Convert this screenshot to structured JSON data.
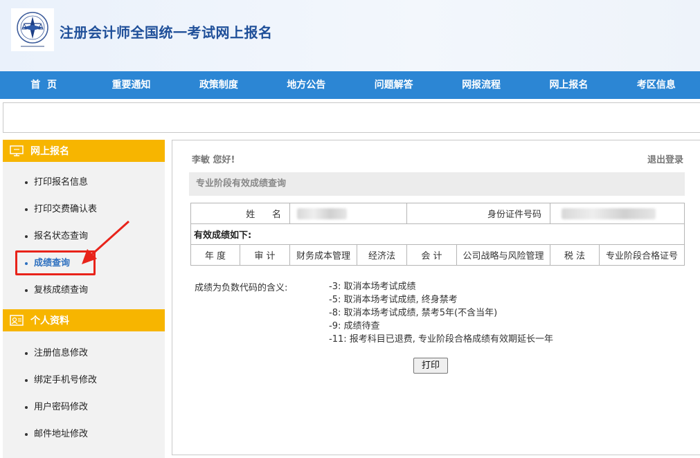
{
  "header": {
    "site_title": "注册会计师全国统一考试网上报名",
    "logo_icon": "cicpa-emblem-icon"
  },
  "nav": {
    "items": [
      {
        "label": "首  页"
      },
      {
        "label": "重要通知"
      },
      {
        "label": "政策制度"
      },
      {
        "label": "地方公告"
      },
      {
        "label": "问题解答"
      },
      {
        "label": "网报流程"
      },
      {
        "label": "网上报名"
      },
      {
        "label": "考区信息"
      }
    ]
  },
  "sidebar": {
    "section1": {
      "title": "网上报名",
      "icon": "monitor-icon",
      "items": [
        {
          "label": "打印报名信息"
        },
        {
          "label": "打印交费确认表"
        },
        {
          "label": "报名状态查询"
        },
        {
          "label": "成绩查询"
        },
        {
          "label": "复核成绩查询"
        }
      ]
    },
    "section2": {
      "title": "个人资料",
      "icon": "id-card-icon",
      "items": [
        {
          "label": "注册信息修改"
        },
        {
          "label": "绑定手机号修改"
        },
        {
          "label": "用户密码修改"
        },
        {
          "label": "邮件地址修改"
        }
      ]
    },
    "active_item": "成绩查询"
  },
  "main": {
    "greeting": "李敏 您好!",
    "logout": "退出登录",
    "section_title": "专业阶段有效成绩查询",
    "name_label": "姓      名",
    "id_label": "身份证件号码",
    "scores_caption": "有效成绩如下:",
    "score_columns": [
      "年 度",
      "审 计",
      "财务成本管理",
      "经济法",
      "会 计",
      "公司战略与风险管理",
      "税 法",
      "专业阶段合格证号"
    ],
    "notes_label": "成绩为负数代码的含义:",
    "notes": [
      "-3: 取消本场考试成绩",
      "-5: 取消本场考试成绩, 终身禁考",
      "-8: 取消本场考试成绩, 禁考5年(不含当年)",
      "-9: 成绩待查",
      "-11: 报考科目已退费, 专业阶段合格成绩有效期延长一年"
    ],
    "print_label": "打印"
  },
  "colors": {
    "nav_bg": "#2c86d4",
    "sidebar_header_bg": "#f7b500",
    "highlight": "#e8231a",
    "active_link": "#2c6fbf"
  }
}
